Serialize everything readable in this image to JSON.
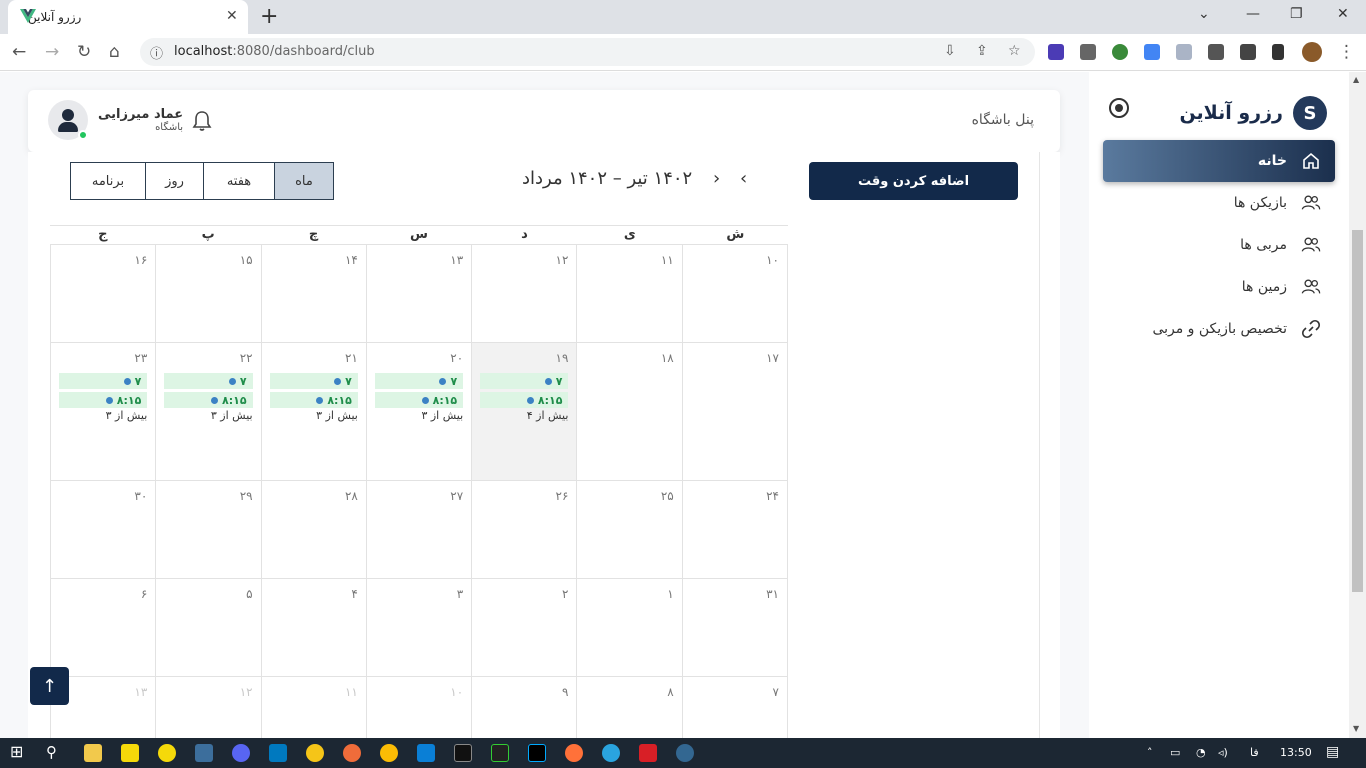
{
  "browser": {
    "tab_title": "رزرو آنلاین",
    "close_glyph": "✕",
    "new_tab_glyph": "+",
    "url_host": "localhost",
    "url_rest": ":8080/dashboard/club"
  },
  "sidebar": {
    "brand": "رزرو آنلاین",
    "items": [
      {
        "label": "خانه",
        "icon": "home-icon",
        "active": true
      },
      {
        "label": "بازیکن ها",
        "icon": "users-icon",
        "active": false
      },
      {
        "label": "مربی ها",
        "icon": "users-icon",
        "active": false
      },
      {
        "label": "زمین ها",
        "icon": "users-icon",
        "active": false
      },
      {
        "label": "تخصیص بازیکن و مربی",
        "icon": "link-icon",
        "active": false
      }
    ]
  },
  "header": {
    "panel_title": "پنل باشگاه",
    "user_name": "عماد میرزایی",
    "user_role": "باشگاه"
  },
  "calendar": {
    "add_button": "اضافه کردن وقت",
    "period_title": "۱۴۰۲ تیر – ۱۴۰۲ مرداد",
    "views": [
      "ماه",
      "هفته",
      "روز",
      "برنامه"
    ],
    "active_view": "ماه",
    "weekdays": [
      "ش",
      "ی",
      "د",
      "س",
      "چ",
      "پ",
      "ج"
    ],
    "weeks": [
      [
        {
          "d": "۱۰"
        },
        {
          "d": "۱۱"
        },
        {
          "d": "۱۲"
        },
        {
          "d": "۱۳"
        },
        {
          "d": "۱۴"
        },
        {
          "d": "۱۵"
        },
        {
          "d": "۱۶"
        }
      ],
      [
        {
          "d": "۱۷"
        },
        {
          "d": "۱۸"
        },
        {
          "d": "۱۹",
          "today": true,
          "events": [
            "۷",
            "۸:۱۵"
          ],
          "more": "بیش از ۴"
        },
        {
          "d": "۲۰",
          "events": [
            "۷",
            "۸:۱۵"
          ],
          "more": "بیش از ۳"
        },
        {
          "d": "۲۱",
          "events": [
            "۷",
            "۸:۱۵"
          ],
          "more": "بیش از ۳"
        },
        {
          "d": "۲۲",
          "events": [
            "۷",
            "۸:۱۵"
          ],
          "more": "بیش از ۳"
        },
        {
          "d": "۲۳",
          "events": [
            "۷",
            "۸:۱۵"
          ],
          "more": "بیش از ۳"
        }
      ],
      [
        {
          "d": "۲۴"
        },
        {
          "d": "۲۵"
        },
        {
          "d": "۲۶"
        },
        {
          "d": "۲۷"
        },
        {
          "d": "۲۸"
        },
        {
          "d": "۲۹"
        },
        {
          "d": "۳۰"
        }
      ],
      [
        {
          "d": "۳۱"
        },
        {
          "d": "۱"
        },
        {
          "d": "۲"
        },
        {
          "d": "۳"
        },
        {
          "d": "۴"
        },
        {
          "d": "۵"
        },
        {
          "d": "۶"
        }
      ],
      [
        {
          "d": "۷"
        },
        {
          "d": "۸"
        },
        {
          "d": "۹"
        },
        {
          "d": "۱۰",
          "faded": true
        },
        {
          "d": "۱۱",
          "faded": true
        },
        {
          "d": "۱۲",
          "faded": true
        },
        {
          "d": "۱۳",
          "faded": true
        }
      ]
    ]
  },
  "taskbar": {
    "lang": "فا",
    "time": "13:50"
  }
}
